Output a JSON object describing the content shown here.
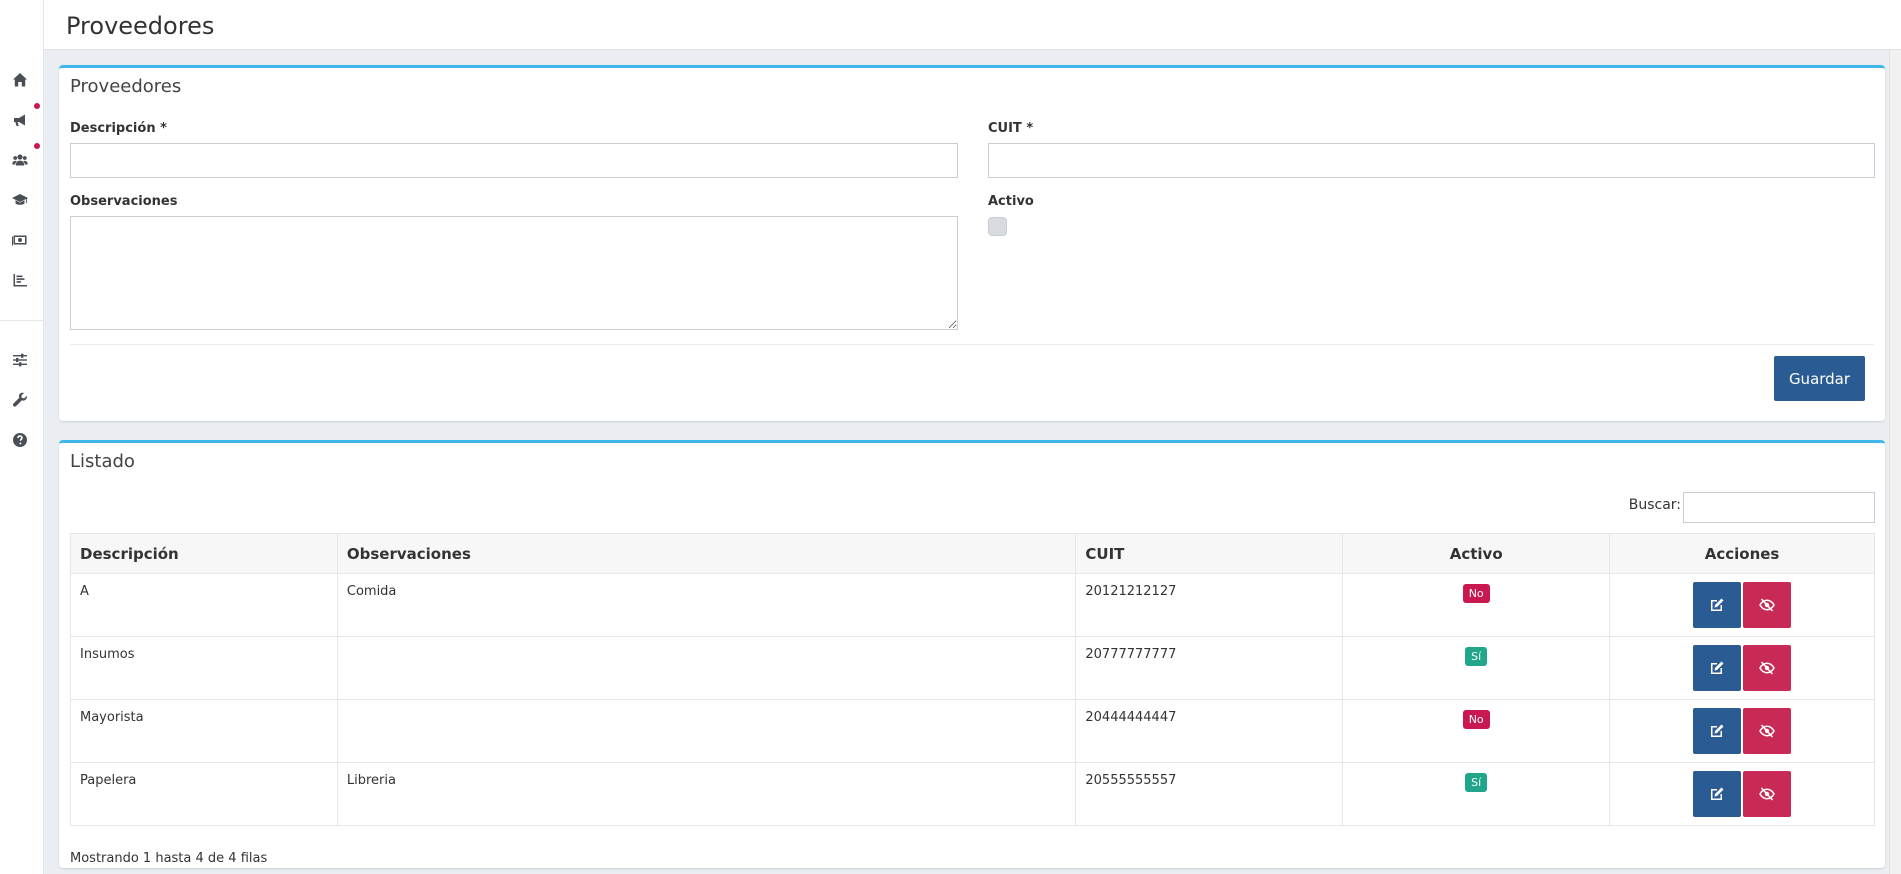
{
  "header": {
    "title": "Proveedores"
  },
  "sidebar": {
    "items": [
      {
        "icon": "home-icon",
        "has_dot": false
      },
      {
        "icon": "megaphone-icon",
        "has_dot": true
      },
      {
        "icon": "users-icon",
        "has_dot": true
      },
      {
        "icon": "graduation-cap-icon",
        "has_dot": false
      },
      {
        "icon": "money-icon",
        "has_dot": false
      },
      {
        "icon": "chart-icon",
        "has_dot": false
      },
      {
        "icon": "sliders-icon",
        "has_dot": false
      },
      {
        "icon": "wrench-icon",
        "has_dot": false
      },
      {
        "icon": "help-icon",
        "has_dot": false
      }
    ],
    "dot_color": "#c9174f"
  },
  "form": {
    "title": "Proveedores",
    "descripcion_label": "Descripción *",
    "descripcion_value": "",
    "cuit_label": "CUIT *",
    "cuit_value": "",
    "observaciones_label": "Observaciones",
    "observaciones_value": "",
    "activo_label": "Activo",
    "activo_checked": false,
    "save_label": "Guardar"
  },
  "list": {
    "title": "Listado",
    "search_label": "Buscar:",
    "search_value": "",
    "columns": [
      "Descripción",
      "Observaciones",
      "CUIT",
      "Activo",
      "Acciones"
    ],
    "rows": [
      {
        "descripcion": "A",
        "observaciones": "Comida",
        "cuit": "20121212127",
        "activo": "No"
      },
      {
        "descripcion": "Insumos",
        "observaciones": "",
        "cuit": "20777777777",
        "activo": "Sí"
      },
      {
        "descripcion": "Mayorista",
        "observaciones": "",
        "cuit": "20444444447",
        "activo": "No"
      },
      {
        "descripcion": "Papelera",
        "observaciones": "Libreria",
        "cuit": "20555555557",
        "activo": "Sí"
      }
    ],
    "footer": "Mostrando 1 hasta 4 de 4 filas"
  },
  "colors": {
    "accent": "#3fb7e8",
    "primary": "#2a5b92",
    "danger": "#c92a55",
    "badge_no": "#c9174f",
    "badge_si": "#21a68b"
  }
}
